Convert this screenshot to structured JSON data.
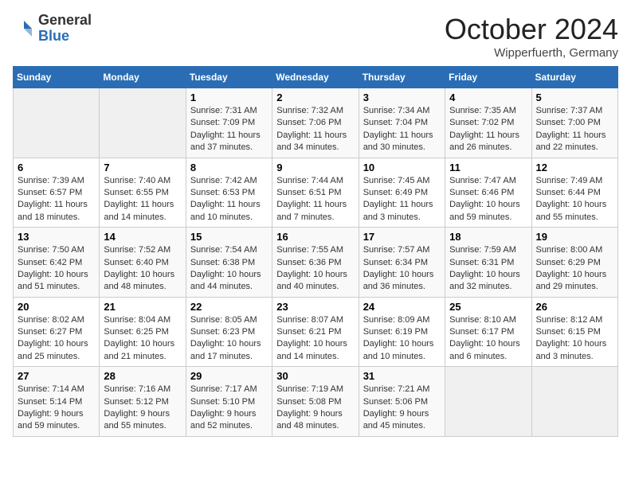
{
  "header": {
    "logo_general": "General",
    "logo_blue": "Blue",
    "month_title": "October 2024",
    "location": "Wipperfuerth, Germany"
  },
  "days_of_week": [
    "Sunday",
    "Monday",
    "Tuesday",
    "Wednesday",
    "Thursday",
    "Friday",
    "Saturday"
  ],
  "weeks": [
    [
      {
        "day": "",
        "info": ""
      },
      {
        "day": "",
        "info": ""
      },
      {
        "day": "1",
        "info": "Sunrise: 7:31 AM\nSunset: 7:09 PM\nDaylight: 11 hours and 37 minutes."
      },
      {
        "day": "2",
        "info": "Sunrise: 7:32 AM\nSunset: 7:06 PM\nDaylight: 11 hours and 34 minutes."
      },
      {
        "day": "3",
        "info": "Sunrise: 7:34 AM\nSunset: 7:04 PM\nDaylight: 11 hours and 30 minutes."
      },
      {
        "day": "4",
        "info": "Sunrise: 7:35 AM\nSunset: 7:02 PM\nDaylight: 11 hours and 26 minutes."
      },
      {
        "day": "5",
        "info": "Sunrise: 7:37 AM\nSunset: 7:00 PM\nDaylight: 11 hours and 22 minutes."
      }
    ],
    [
      {
        "day": "6",
        "info": "Sunrise: 7:39 AM\nSunset: 6:57 PM\nDaylight: 11 hours and 18 minutes."
      },
      {
        "day": "7",
        "info": "Sunrise: 7:40 AM\nSunset: 6:55 PM\nDaylight: 11 hours and 14 minutes."
      },
      {
        "day": "8",
        "info": "Sunrise: 7:42 AM\nSunset: 6:53 PM\nDaylight: 11 hours and 10 minutes."
      },
      {
        "day": "9",
        "info": "Sunrise: 7:44 AM\nSunset: 6:51 PM\nDaylight: 11 hours and 7 minutes."
      },
      {
        "day": "10",
        "info": "Sunrise: 7:45 AM\nSunset: 6:49 PM\nDaylight: 11 hours and 3 minutes."
      },
      {
        "day": "11",
        "info": "Sunrise: 7:47 AM\nSunset: 6:46 PM\nDaylight: 10 hours and 59 minutes."
      },
      {
        "day": "12",
        "info": "Sunrise: 7:49 AM\nSunset: 6:44 PM\nDaylight: 10 hours and 55 minutes."
      }
    ],
    [
      {
        "day": "13",
        "info": "Sunrise: 7:50 AM\nSunset: 6:42 PM\nDaylight: 10 hours and 51 minutes."
      },
      {
        "day": "14",
        "info": "Sunrise: 7:52 AM\nSunset: 6:40 PM\nDaylight: 10 hours and 48 minutes."
      },
      {
        "day": "15",
        "info": "Sunrise: 7:54 AM\nSunset: 6:38 PM\nDaylight: 10 hours and 44 minutes."
      },
      {
        "day": "16",
        "info": "Sunrise: 7:55 AM\nSunset: 6:36 PM\nDaylight: 10 hours and 40 minutes."
      },
      {
        "day": "17",
        "info": "Sunrise: 7:57 AM\nSunset: 6:34 PM\nDaylight: 10 hours and 36 minutes."
      },
      {
        "day": "18",
        "info": "Sunrise: 7:59 AM\nSunset: 6:31 PM\nDaylight: 10 hours and 32 minutes."
      },
      {
        "day": "19",
        "info": "Sunrise: 8:00 AM\nSunset: 6:29 PM\nDaylight: 10 hours and 29 minutes."
      }
    ],
    [
      {
        "day": "20",
        "info": "Sunrise: 8:02 AM\nSunset: 6:27 PM\nDaylight: 10 hours and 25 minutes."
      },
      {
        "day": "21",
        "info": "Sunrise: 8:04 AM\nSunset: 6:25 PM\nDaylight: 10 hours and 21 minutes."
      },
      {
        "day": "22",
        "info": "Sunrise: 8:05 AM\nSunset: 6:23 PM\nDaylight: 10 hours and 17 minutes."
      },
      {
        "day": "23",
        "info": "Sunrise: 8:07 AM\nSunset: 6:21 PM\nDaylight: 10 hours and 14 minutes."
      },
      {
        "day": "24",
        "info": "Sunrise: 8:09 AM\nSunset: 6:19 PM\nDaylight: 10 hours and 10 minutes."
      },
      {
        "day": "25",
        "info": "Sunrise: 8:10 AM\nSunset: 6:17 PM\nDaylight: 10 hours and 6 minutes."
      },
      {
        "day": "26",
        "info": "Sunrise: 8:12 AM\nSunset: 6:15 PM\nDaylight: 10 hours and 3 minutes."
      }
    ],
    [
      {
        "day": "27",
        "info": "Sunrise: 7:14 AM\nSunset: 5:14 PM\nDaylight: 9 hours and 59 minutes."
      },
      {
        "day": "28",
        "info": "Sunrise: 7:16 AM\nSunset: 5:12 PM\nDaylight: 9 hours and 55 minutes."
      },
      {
        "day": "29",
        "info": "Sunrise: 7:17 AM\nSunset: 5:10 PM\nDaylight: 9 hours and 52 minutes."
      },
      {
        "day": "30",
        "info": "Sunrise: 7:19 AM\nSunset: 5:08 PM\nDaylight: 9 hours and 48 minutes."
      },
      {
        "day": "31",
        "info": "Sunrise: 7:21 AM\nSunset: 5:06 PM\nDaylight: 9 hours and 45 minutes."
      },
      {
        "day": "",
        "info": ""
      },
      {
        "day": "",
        "info": ""
      }
    ]
  ]
}
